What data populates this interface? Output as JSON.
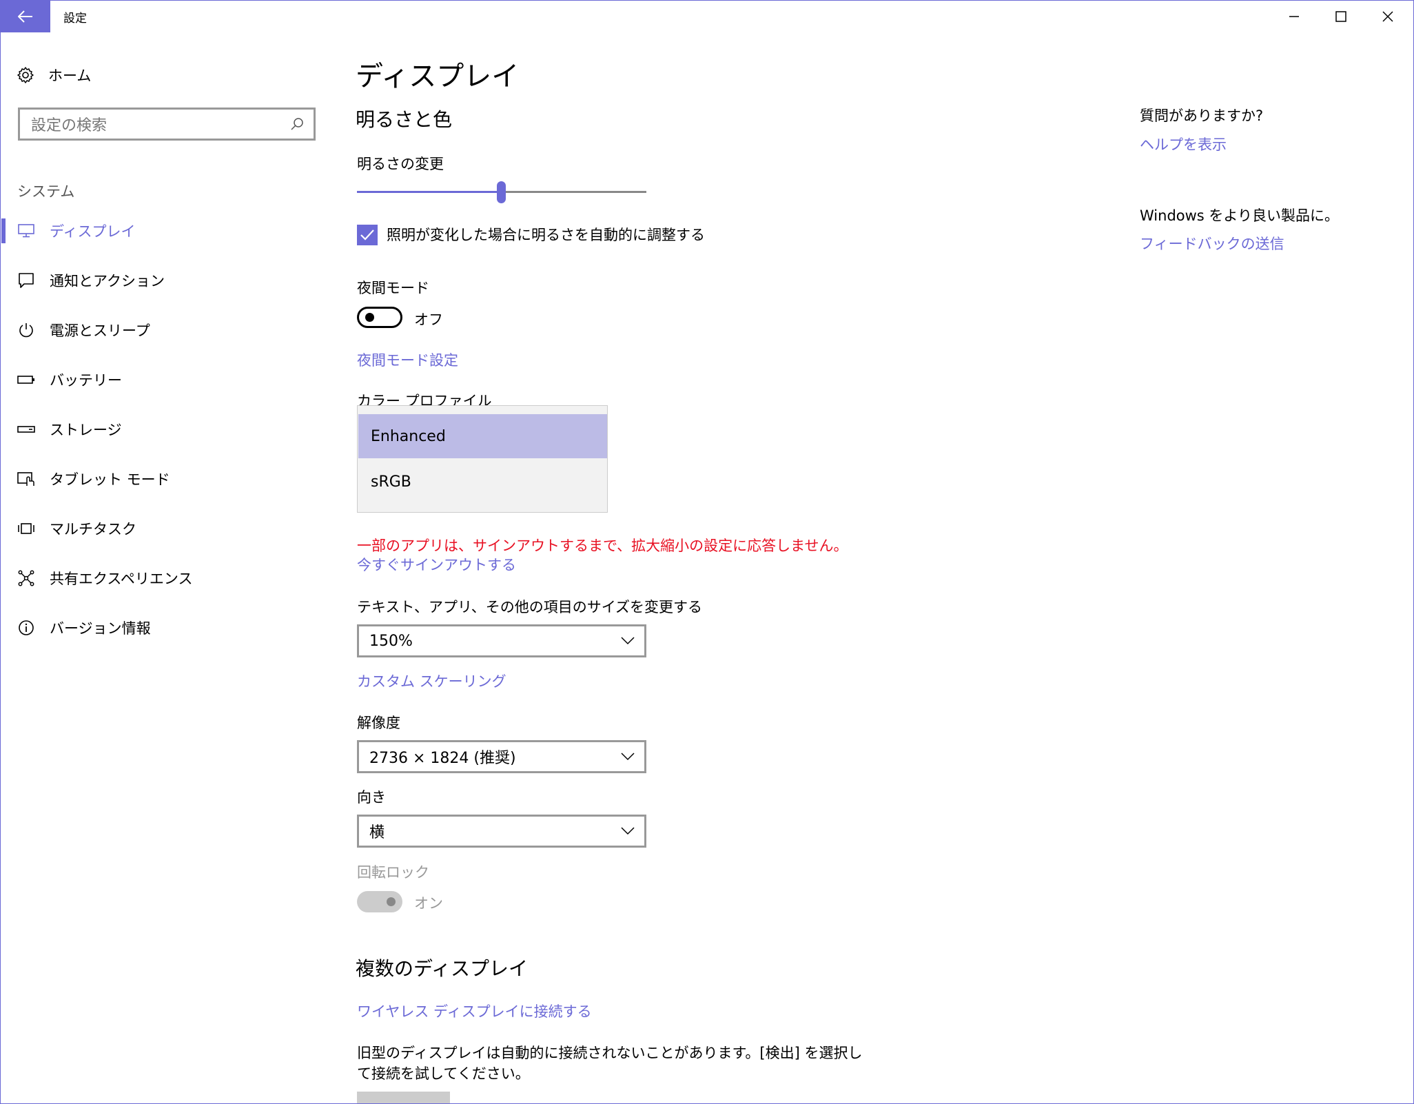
{
  "window": {
    "title": "設定"
  },
  "sidebar": {
    "home_label": "ホーム",
    "search_placeholder": "設定の検索",
    "section_label": "システム",
    "items": [
      {
        "label": "ディスプレイ",
        "icon": "monitor-icon",
        "active": true
      },
      {
        "label": "通知とアクション",
        "icon": "message-icon"
      },
      {
        "label": "電源とスリープ",
        "icon": "power-icon"
      },
      {
        "label": "バッテリー",
        "icon": "battery-icon"
      },
      {
        "label": "ストレージ",
        "icon": "drive-icon"
      },
      {
        "label": "タブレット モード",
        "icon": "tablet-mode-icon"
      },
      {
        "label": "マルチタスク",
        "icon": "multitask-icon"
      },
      {
        "label": "共有エクスペリエンス",
        "icon": "share-icon"
      },
      {
        "label": "バージョン情報",
        "icon": "info-icon"
      }
    ]
  },
  "main": {
    "page_title": "ディスプレイ",
    "brightness_section": "明るさと色",
    "brightness_label": "明るさの変更",
    "brightness_value": 0.5,
    "auto_brightness_label": "照明が変化した場合に明るさを自動的に調整する",
    "auto_brightness_checked": true,
    "night_mode_label": "夜間モード",
    "night_mode_state": "オフ",
    "night_mode_settings_link": "夜間モード設定",
    "color_profile_label": "カラー プロファイル",
    "color_profile_options": [
      "Enhanced",
      "sRGB"
    ],
    "color_profile_selected": "Enhanced",
    "warning_text": "一部のアプリは、サインアウトするまで、拡大縮小の設定に応答しません。",
    "sign_out_link": "今すぐサインアウトする",
    "scale_label": "テキスト、アプリ、その他の項目のサイズを変更する",
    "scale_value": "150%",
    "custom_scaling_link": "カスタム スケーリング",
    "resolution_label": "解像度",
    "resolution_value": "2736 × 1824 (推奨)",
    "orientation_label": "向き",
    "orientation_value": "横",
    "rotation_lock_label": "回転ロック",
    "rotation_lock_state": "オン",
    "multi_display_section": "複数のディスプレイ",
    "wireless_link": "ワイヤレス ディスプレイに接続する",
    "legacy_text_line1": "旧型のディスプレイは自動的に接続されないことがあります。[検出] を選択し",
    "legacy_text_line2": "て接続を試してください。"
  },
  "right_panel": {
    "question_heading": "質問がありますか?",
    "help_link": "ヘルプを表示",
    "feedback_heading": "Windows をより良い製品に。",
    "feedback_link": "フィードバックの送信"
  },
  "colors": {
    "accent": "#6b69d6",
    "warning": "#e81123",
    "selected_option": "#bcbbe6"
  }
}
